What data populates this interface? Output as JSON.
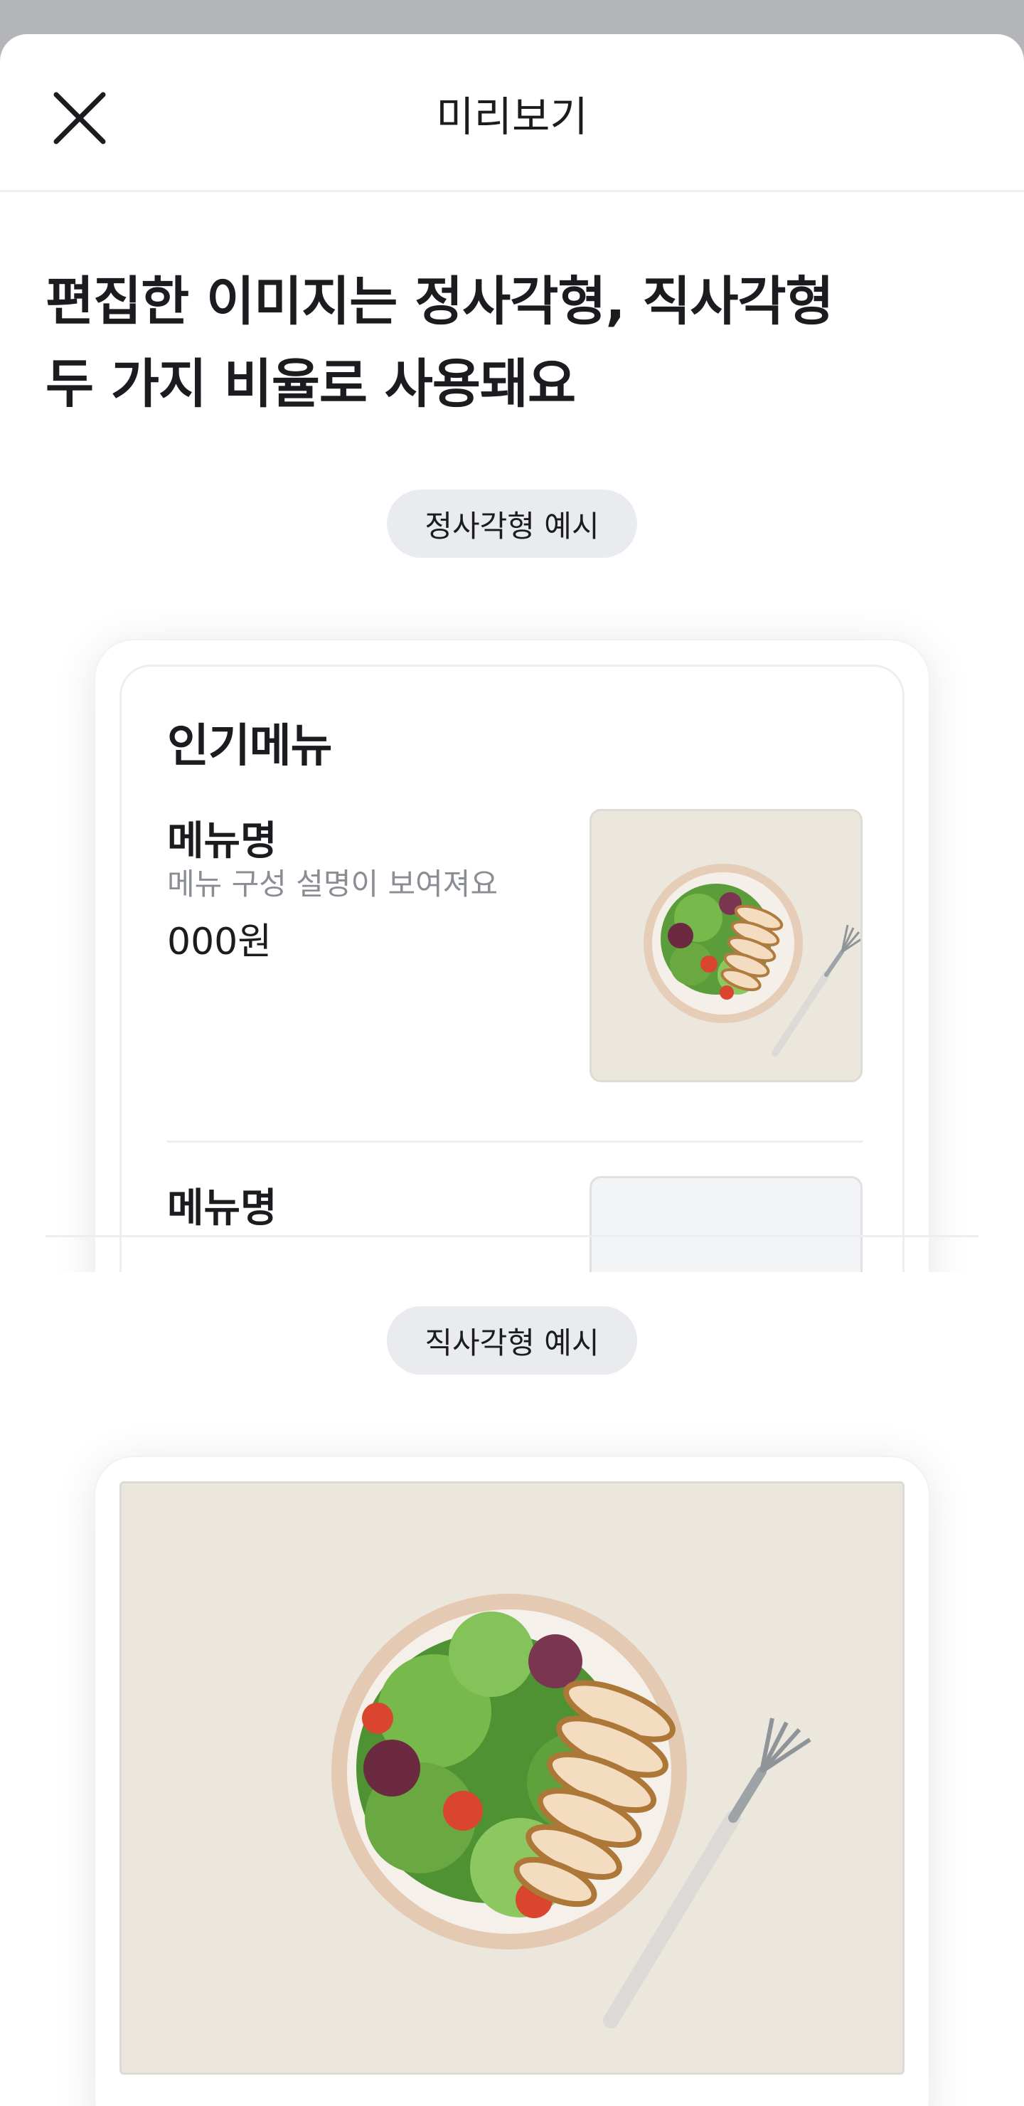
{
  "header": {
    "title": "미리보기",
    "close_icon": "close-icon"
  },
  "headline": {
    "line1": "편집한 이미지는 정사각형, 직사각형",
    "line2": "두 가지 비율로 사용돼요"
  },
  "square_example": {
    "badge": "정사각형 예시",
    "section_title": "인기메뉴",
    "items": [
      {
        "name": "메뉴명",
        "description": "메뉴 구성 설명이 보여져요",
        "price": "000원",
        "image": "salad-bowl-photo"
      },
      {
        "name": "메뉴명",
        "image": "empty-placeholder"
      }
    ]
  },
  "rect_example": {
    "badge": "직사각형 예시",
    "image": "salad-bowl-photo"
  },
  "colors": {
    "text": "#1b1c1f",
    "muted": "#8a8d94",
    "pill_bg": "#eaebee",
    "photo_bg": "#ece7dc"
  }
}
